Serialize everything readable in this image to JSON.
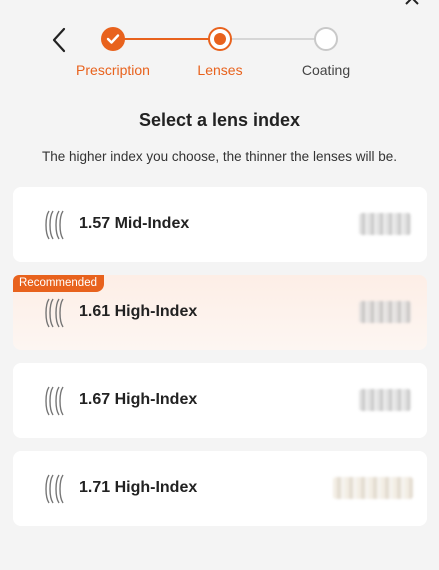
{
  "nav": {
    "back_icon": "chevron-left-icon",
    "close_icon": "close-icon"
  },
  "stepper": {
    "steps": [
      {
        "label": "Prescription",
        "state": "completed"
      },
      {
        "label": "Lenses",
        "state": "current"
      },
      {
        "label": "Coating",
        "state": "pending"
      }
    ],
    "accent_color": "#e8621d",
    "inactive_color": "#c9c9c9"
  },
  "page": {
    "title": "Select a lens index",
    "subtitle": "The higher index you choose, the thinner the lenses will be."
  },
  "options": [
    {
      "label": "1.57 Mid-Index",
      "badge": "",
      "icon": "lens-profile-icon"
    },
    {
      "label": "1.61 High-Index",
      "badge": "Recommended",
      "icon": "lens-profile-icon"
    },
    {
      "label": "1.67 High-Index",
      "badge": "",
      "icon": "lens-profile-icon"
    },
    {
      "label": "1.71 High-Index",
      "badge": "",
      "icon": "lens-profile-icon"
    }
  ]
}
